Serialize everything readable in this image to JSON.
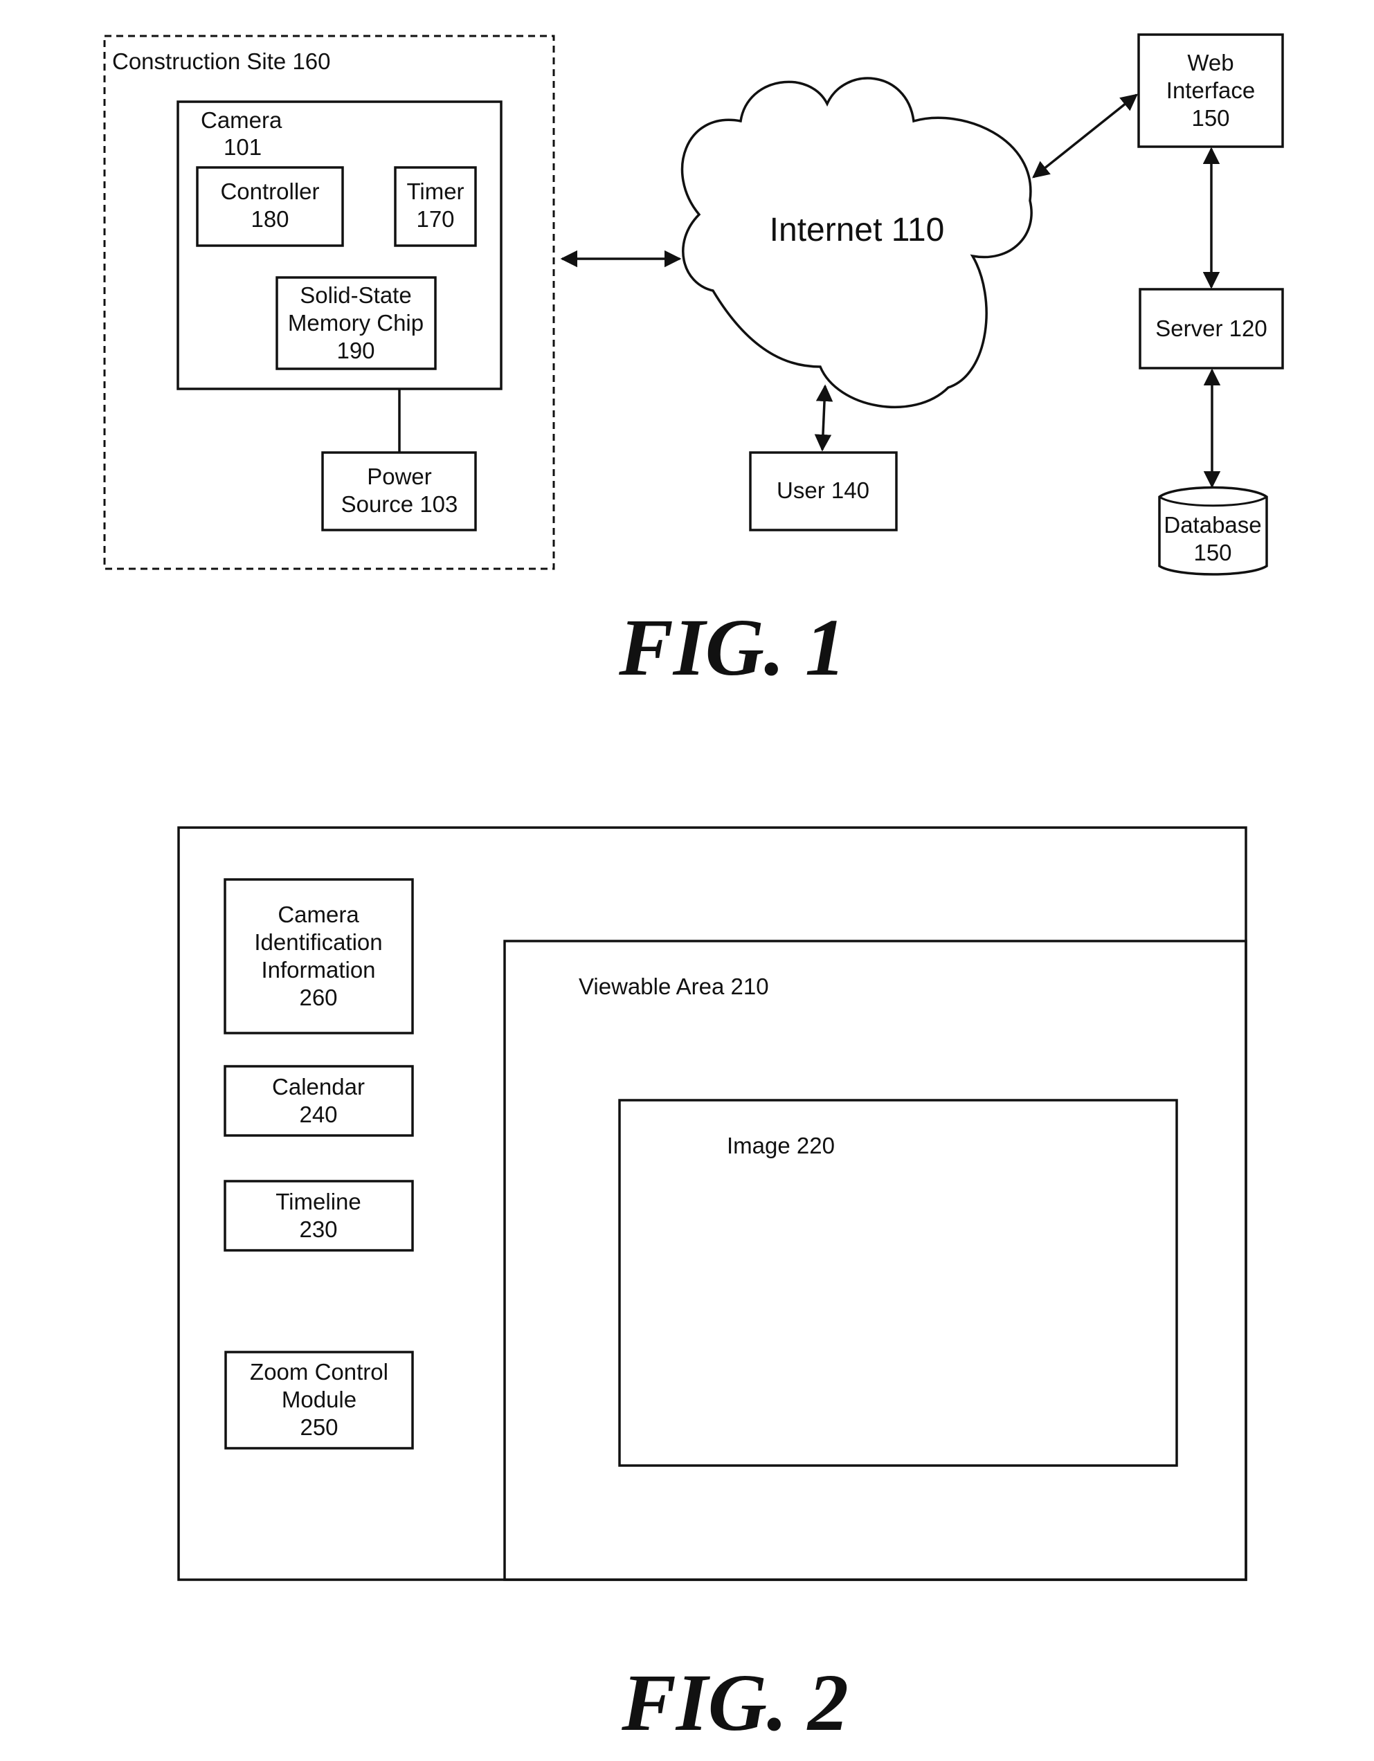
{
  "fig1": {
    "caption": "FIG. 1",
    "construction_site": "Construction Site 160",
    "camera": {
      "line1": "Camera",
      "line2": "101"
    },
    "controller": {
      "line1": "Controller",
      "line2": "180"
    },
    "timer": {
      "line1": "Timer",
      "line2": "170"
    },
    "memory": {
      "line1": "Solid-State",
      "line2": "Memory Chip",
      "line3": "190"
    },
    "power": {
      "line1": "Power",
      "line2": "Source 103"
    },
    "internet": "Internet 110",
    "web_interface": {
      "line1": "Web",
      "line2": "Interface",
      "line3": "150"
    },
    "server": "Server 120",
    "database": {
      "line1": "Database",
      "line2": "150"
    },
    "user": "User 140"
  },
  "fig2": {
    "caption": "FIG. 2",
    "viewable_area": "Viewable Area 210",
    "image": "Image 220",
    "camera_id": {
      "line1": "Camera",
      "line2": "Identification",
      "line3": "Information",
      "line4": "260"
    },
    "calendar": {
      "line1": "Calendar",
      "line2": "240"
    },
    "timeline": {
      "line1": "Timeline",
      "line2": "230"
    },
    "zoom_control": {
      "line1": "Zoom Control",
      "line2": "Module",
      "line3": "250"
    }
  }
}
